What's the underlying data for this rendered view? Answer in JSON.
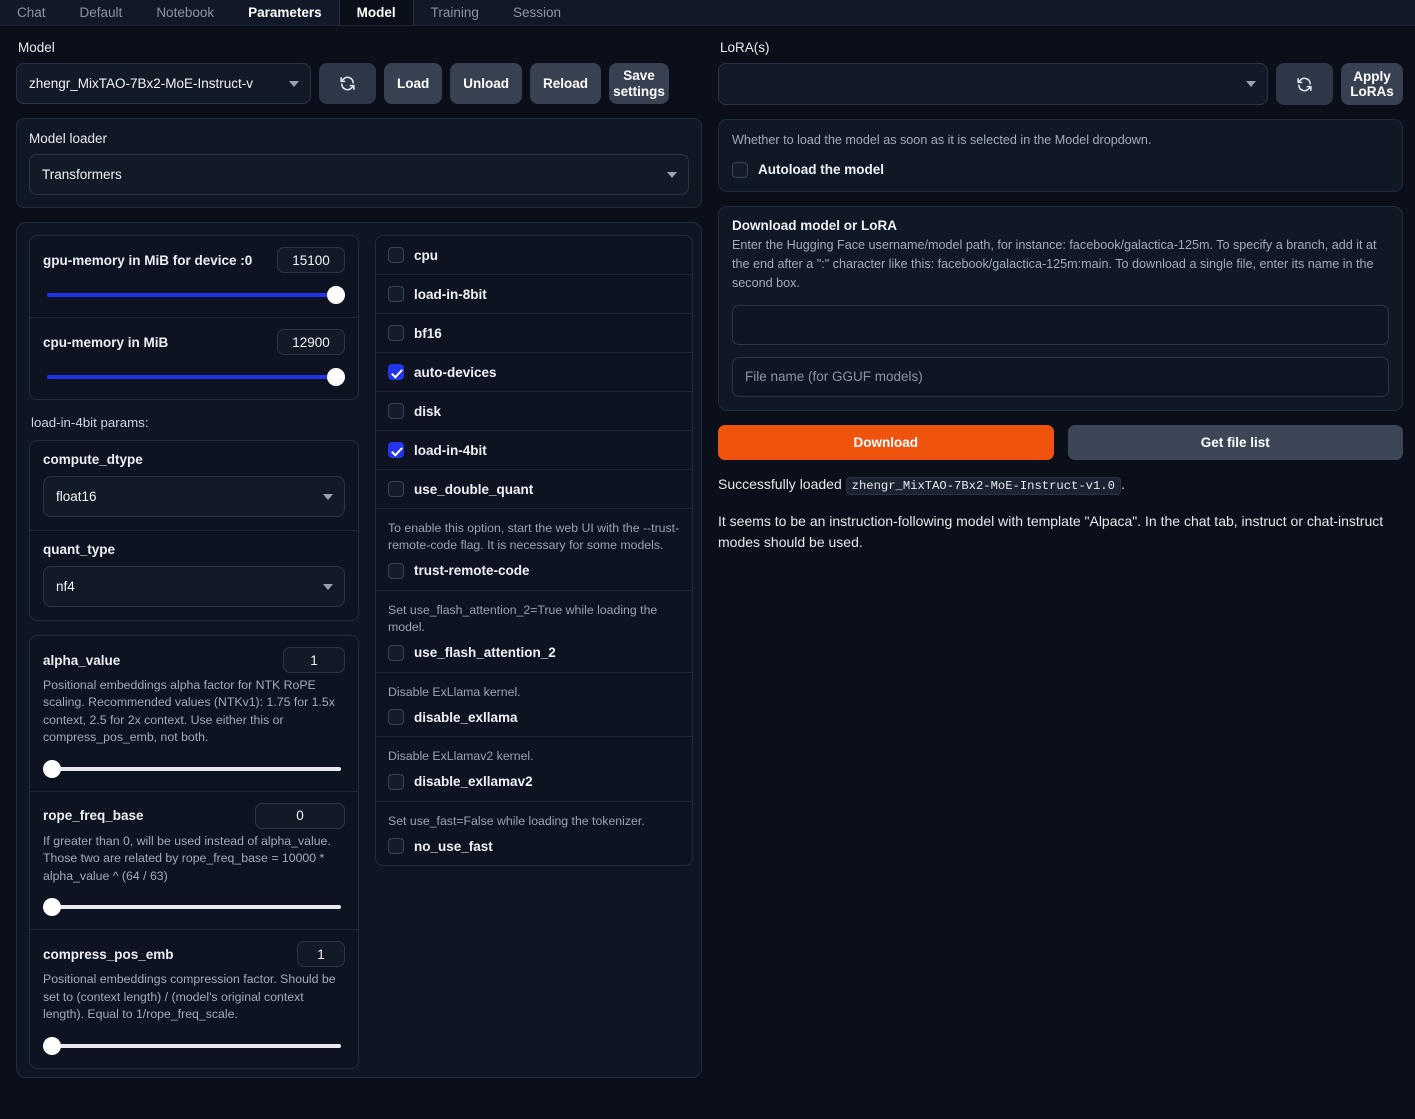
{
  "tabs": [
    {
      "label": "Chat",
      "state": "normal"
    },
    {
      "label": "Default",
      "state": "normal"
    },
    {
      "label": "Notebook",
      "state": "normal"
    },
    {
      "label": "Parameters",
      "state": "bold"
    },
    {
      "label": "Model",
      "state": "active"
    },
    {
      "label": "Training",
      "state": "normal"
    },
    {
      "label": "Session",
      "state": "normal"
    }
  ],
  "model": {
    "label": "Model",
    "selected": "zhengr_MixTAO-7Bx2-MoE-Instruct-v",
    "refresh_icon": "refresh-icon",
    "buttons": {
      "load": "Load",
      "unload": "Unload",
      "reload": "Reload",
      "save_settings": "Save settings"
    }
  },
  "model_loader": {
    "title": "Model loader",
    "selected": "Transformers"
  },
  "memory": {
    "gpu": {
      "label": "gpu-memory in MiB for device :0",
      "value": "15100"
    },
    "cpu": {
      "label": "cpu-memory in MiB",
      "value": "12900"
    }
  },
  "load_in_4bit_params_note": "load-in-4bit params:",
  "compute_dtype": {
    "label": "compute_dtype",
    "value": "float16"
  },
  "quant_type": {
    "label": "quant_type",
    "value": "nf4"
  },
  "sliders": [
    {
      "name": "alpha_value",
      "value": "1",
      "desc": "Positional embeddings alpha factor for NTK RoPE scaling. Recommended values (NTKv1): 1.75 for 1.5x context, 2.5 for 2x context. Use either this or compress_pos_emb, not both."
    },
    {
      "name": "rope_freq_base",
      "value": "0",
      "desc": "If greater than 0, will be used instead of alpha_value. Those two are related by rope_freq_base = 10000 * alpha_value ^ (64 / 63)"
    },
    {
      "name": "compress_pos_emb",
      "value": "1",
      "desc": "Positional embeddings compression factor. Should be set to (context length) / (model's original context length). Equal to 1/rope_freq_scale."
    }
  ],
  "checkboxes": [
    {
      "label": "cpu",
      "checked": false,
      "desc": ""
    },
    {
      "label": "load-in-8bit",
      "checked": false,
      "desc": ""
    },
    {
      "label": "bf16",
      "checked": false,
      "desc": ""
    },
    {
      "label": "auto-devices",
      "checked": true,
      "desc": ""
    },
    {
      "label": "disk",
      "checked": false,
      "desc": ""
    },
    {
      "label": "load-in-4bit",
      "checked": true,
      "desc": ""
    },
    {
      "label": "use_double_quant",
      "checked": false,
      "desc": ""
    },
    {
      "label": "trust-remote-code",
      "checked": false,
      "desc": "To enable this option, start the web UI with the --trust-remote-code flag. It is necessary for some models."
    },
    {
      "label": "use_flash_attention_2",
      "checked": false,
      "desc": "Set use_flash_attention_2=True while loading the model."
    },
    {
      "label": "disable_exllama",
      "checked": false,
      "desc": "Disable ExLlama kernel."
    },
    {
      "label": "disable_exllamav2",
      "checked": false,
      "desc": "Disable ExLlamav2 kernel."
    },
    {
      "label": "no_use_fast",
      "checked": false,
      "desc": "Set use_fast=False while loading the tokenizer."
    }
  ],
  "lora": {
    "label": "LoRA(s)",
    "selected": "",
    "refresh_icon": "refresh-icon",
    "apply_button": "Apply LoRAs"
  },
  "autoload": {
    "desc": "Whether to load the model as soon as it is selected in the Model dropdown.",
    "label": "Autoload the model",
    "checked": false
  },
  "download": {
    "title": "Download model or LoRA",
    "desc": "Enter the Hugging Face username/model path, for instance: facebook/galactica-125m. To specify a branch, add it at the end after a \":\" character like this: facebook/galactica-125m:main. To download a single file, enter its name in the second box.",
    "repo_value": "",
    "file_placeholder": "File name (for GGUF models)",
    "download_button": "Download",
    "filelist_button": "Get file list"
  },
  "status": {
    "prefix": "Successfully loaded",
    "model_chip": "zhengr_MixTAO-7Bx2-MoE-Instruct-v1.0",
    "suffix": ".",
    "paragraph": "It seems to be an instruction-following model with template \"Alpaca\". In the chat tab, instruct or chat-instruct modes should be used."
  },
  "colors": {
    "accent_blue": "#2235e8",
    "download_orange": "#f0530d",
    "background": "#0b0f19",
    "panel": "#101725"
  }
}
